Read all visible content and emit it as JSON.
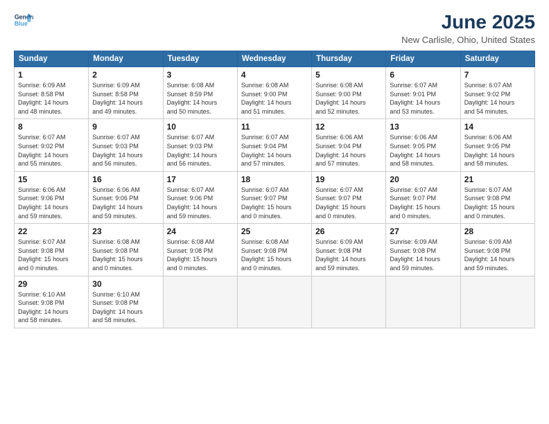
{
  "logo": {
    "line1": "General",
    "line2": "Blue"
  },
  "title": "June 2025",
  "subtitle": "New Carlisle, Ohio, United States",
  "weekdays": [
    "Sunday",
    "Monday",
    "Tuesday",
    "Wednesday",
    "Thursday",
    "Friday",
    "Saturday"
  ],
  "weeks": [
    [
      {
        "day": "1",
        "info": "Sunrise: 6:09 AM\nSunset: 8:58 PM\nDaylight: 14 hours\nand 48 minutes."
      },
      {
        "day": "2",
        "info": "Sunrise: 6:09 AM\nSunset: 8:58 PM\nDaylight: 14 hours\nand 49 minutes."
      },
      {
        "day": "3",
        "info": "Sunrise: 6:08 AM\nSunset: 8:59 PM\nDaylight: 14 hours\nand 50 minutes."
      },
      {
        "day": "4",
        "info": "Sunrise: 6:08 AM\nSunset: 9:00 PM\nDaylight: 14 hours\nand 51 minutes."
      },
      {
        "day": "5",
        "info": "Sunrise: 6:08 AM\nSunset: 9:00 PM\nDaylight: 14 hours\nand 52 minutes."
      },
      {
        "day": "6",
        "info": "Sunrise: 6:07 AM\nSunset: 9:01 PM\nDaylight: 14 hours\nand 53 minutes."
      },
      {
        "day": "7",
        "info": "Sunrise: 6:07 AM\nSunset: 9:02 PM\nDaylight: 14 hours\nand 54 minutes."
      }
    ],
    [
      {
        "day": "8",
        "info": "Sunrise: 6:07 AM\nSunset: 9:02 PM\nDaylight: 14 hours\nand 55 minutes."
      },
      {
        "day": "9",
        "info": "Sunrise: 6:07 AM\nSunset: 9:03 PM\nDaylight: 14 hours\nand 56 minutes."
      },
      {
        "day": "10",
        "info": "Sunrise: 6:07 AM\nSunset: 9:03 PM\nDaylight: 14 hours\nand 56 minutes."
      },
      {
        "day": "11",
        "info": "Sunrise: 6:07 AM\nSunset: 9:04 PM\nDaylight: 14 hours\nand 57 minutes."
      },
      {
        "day": "12",
        "info": "Sunrise: 6:06 AM\nSunset: 9:04 PM\nDaylight: 14 hours\nand 57 minutes."
      },
      {
        "day": "13",
        "info": "Sunrise: 6:06 AM\nSunset: 9:05 PM\nDaylight: 14 hours\nand 58 minutes."
      },
      {
        "day": "14",
        "info": "Sunrise: 6:06 AM\nSunset: 9:05 PM\nDaylight: 14 hours\nand 58 minutes."
      }
    ],
    [
      {
        "day": "15",
        "info": "Sunrise: 6:06 AM\nSunset: 9:06 PM\nDaylight: 14 hours\nand 59 minutes."
      },
      {
        "day": "16",
        "info": "Sunrise: 6:06 AM\nSunset: 9:06 PM\nDaylight: 14 hours\nand 59 minutes."
      },
      {
        "day": "17",
        "info": "Sunrise: 6:07 AM\nSunset: 9:06 PM\nDaylight: 14 hours\nand 59 minutes."
      },
      {
        "day": "18",
        "info": "Sunrise: 6:07 AM\nSunset: 9:07 PM\nDaylight: 15 hours\nand 0 minutes."
      },
      {
        "day": "19",
        "info": "Sunrise: 6:07 AM\nSunset: 9:07 PM\nDaylight: 15 hours\nand 0 minutes."
      },
      {
        "day": "20",
        "info": "Sunrise: 6:07 AM\nSunset: 9:07 PM\nDaylight: 15 hours\nand 0 minutes."
      },
      {
        "day": "21",
        "info": "Sunrise: 6:07 AM\nSunset: 9:08 PM\nDaylight: 15 hours\nand 0 minutes."
      }
    ],
    [
      {
        "day": "22",
        "info": "Sunrise: 6:07 AM\nSunset: 9:08 PM\nDaylight: 15 hours\nand 0 minutes."
      },
      {
        "day": "23",
        "info": "Sunrise: 6:08 AM\nSunset: 9:08 PM\nDaylight: 15 hours\nand 0 minutes."
      },
      {
        "day": "24",
        "info": "Sunrise: 6:08 AM\nSunset: 9:08 PM\nDaylight: 15 hours\nand 0 minutes."
      },
      {
        "day": "25",
        "info": "Sunrise: 6:08 AM\nSunset: 9:08 PM\nDaylight: 15 hours\nand 0 minutes."
      },
      {
        "day": "26",
        "info": "Sunrise: 6:09 AM\nSunset: 9:08 PM\nDaylight: 14 hours\nand 59 minutes."
      },
      {
        "day": "27",
        "info": "Sunrise: 6:09 AM\nSunset: 9:08 PM\nDaylight: 14 hours\nand 59 minutes."
      },
      {
        "day": "28",
        "info": "Sunrise: 6:09 AM\nSunset: 9:08 PM\nDaylight: 14 hours\nand 59 minutes."
      }
    ],
    [
      {
        "day": "29",
        "info": "Sunrise: 6:10 AM\nSunset: 9:08 PM\nDaylight: 14 hours\nand 58 minutes."
      },
      {
        "day": "30",
        "info": "Sunrise: 6:10 AM\nSunset: 9:08 PM\nDaylight: 14 hours\nand 58 minutes."
      },
      {
        "day": "",
        "info": ""
      },
      {
        "day": "",
        "info": ""
      },
      {
        "day": "",
        "info": ""
      },
      {
        "day": "",
        "info": ""
      },
      {
        "day": "",
        "info": ""
      }
    ]
  ]
}
